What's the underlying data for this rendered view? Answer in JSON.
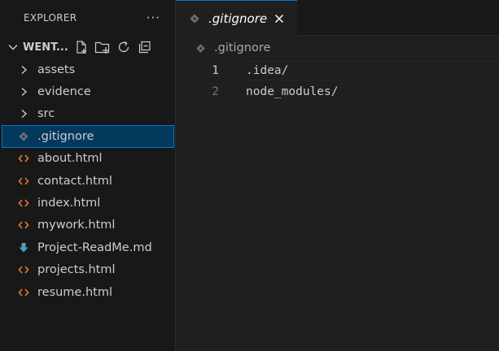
{
  "sidebar": {
    "title": "EXPLORER",
    "more_label": "···",
    "section": {
      "title": "WENT..."
    },
    "items": [
      {
        "label": "assets",
        "type": "folder"
      },
      {
        "label": "evidence",
        "type": "folder"
      },
      {
        "label": "src",
        "type": "folder"
      },
      {
        "label": ".gitignore",
        "type": "git",
        "selected": true
      },
      {
        "label": "about.html",
        "type": "html"
      },
      {
        "label": "contact.html",
        "type": "html"
      },
      {
        "label": "index.html",
        "type": "html"
      },
      {
        "label": "mywork.html",
        "type": "html"
      },
      {
        "label": "Project-ReadMe.md",
        "type": "markdown"
      },
      {
        "label": "projects.html",
        "type": "html"
      },
      {
        "label": "resume.html",
        "type": "html"
      }
    ]
  },
  "editor": {
    "tab": {
      "label": ".gitignore"
    },
    "breadcrumb": {
      "label": ".gitignore"
    },
    "lines": [
      {
        "number": "1",
        "text": ".idea/"
      },
      {
        "number": "2",
        "text": "node_modules/"
      }
    ]
  },
  "colors": {
    "accent": "#0078d4",
    "selection": "#04395e",
    "html_icon": "#e37933",
    "markdown_icon": "#519aba",
    "git_icon": "#6d6d6d"
  },
  "icons": {
    "folder_chevron": "chevron-right-icon",
    "html": "html-code-icon",
    "markdown": "markdown-download-icon",
    "git": "git-diamond-icon"
  }
}
